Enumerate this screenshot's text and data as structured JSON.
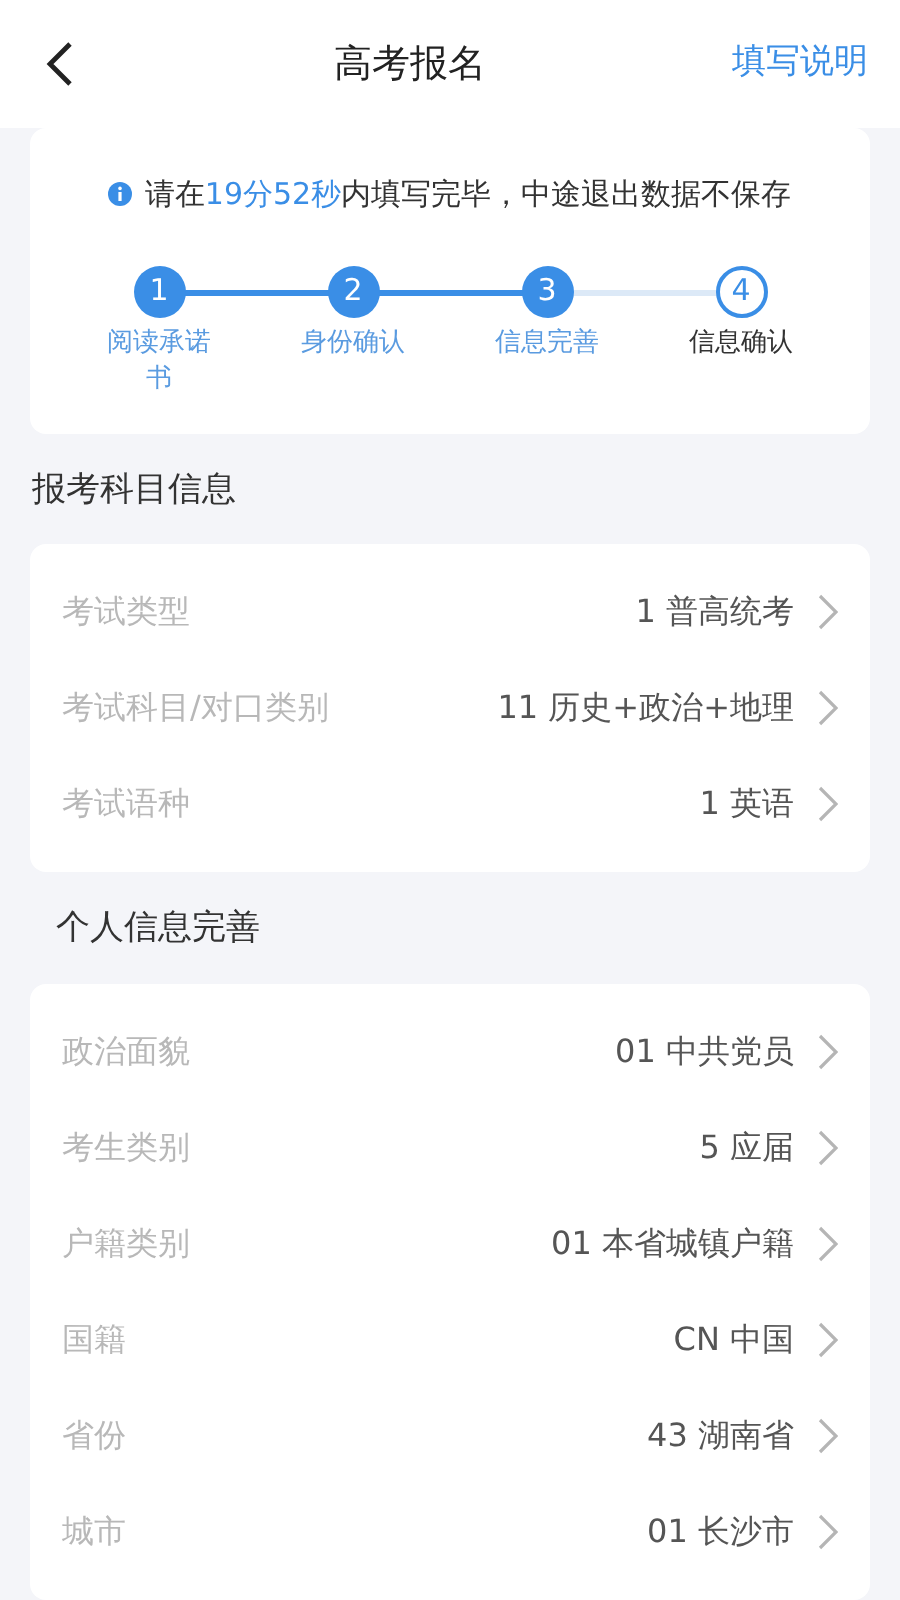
{
  "header": {
    "title": "高考报名",
    "action": "填写说明"
  },
  "notice": {
    "before": "请在",
    "time": "19分52秒",
    "after": "内填写完毕，中途退出数据不保存"
  },
  "steps": [
    {
      "number": "1",
      "label": "阅读承诺书",
      "done": true
    },
    {
      "number": "2",
      "label": "身份确认",
      "done": true
    },
    {
      "number": "3",
      "label": "信息完善",
      "done": true
    },
    {
      "number": "4",
      "label": "信息确认",
      "done": false
    }
  ],
  "sections": [
    {
      "title": "报考科目信息",
      "rows": [
        {
          "label": "考试类型",
          "value": "1 普高统考"
        },
        {
          "label": "考试科目/对口类别",
          "value": "11 历史+政治+地理"
        },
        {
          "label": "考试语种",
          "value": "1 英语"
        }
      ]
    },
    {
      "title": "个人信息完善",
      "rows": [
        {
          "label": "政治面貌",
          "value": "01 中共党员"
        },
        {
          "label": "考生类别",
          "value": "5 应届"
        },
        {
          "label": "户籍类别",
          "value": "01 本省城镇户籍"
        },
        {
          "label": "国籍",
          "value": "CN 中国"
        },
        {
          "label": "省份",
          "value": "43 湖南省"
        },
        {
          "label": "城市",
          "value": "01 长沙市"
        }
      ]
    }
  ]
}
